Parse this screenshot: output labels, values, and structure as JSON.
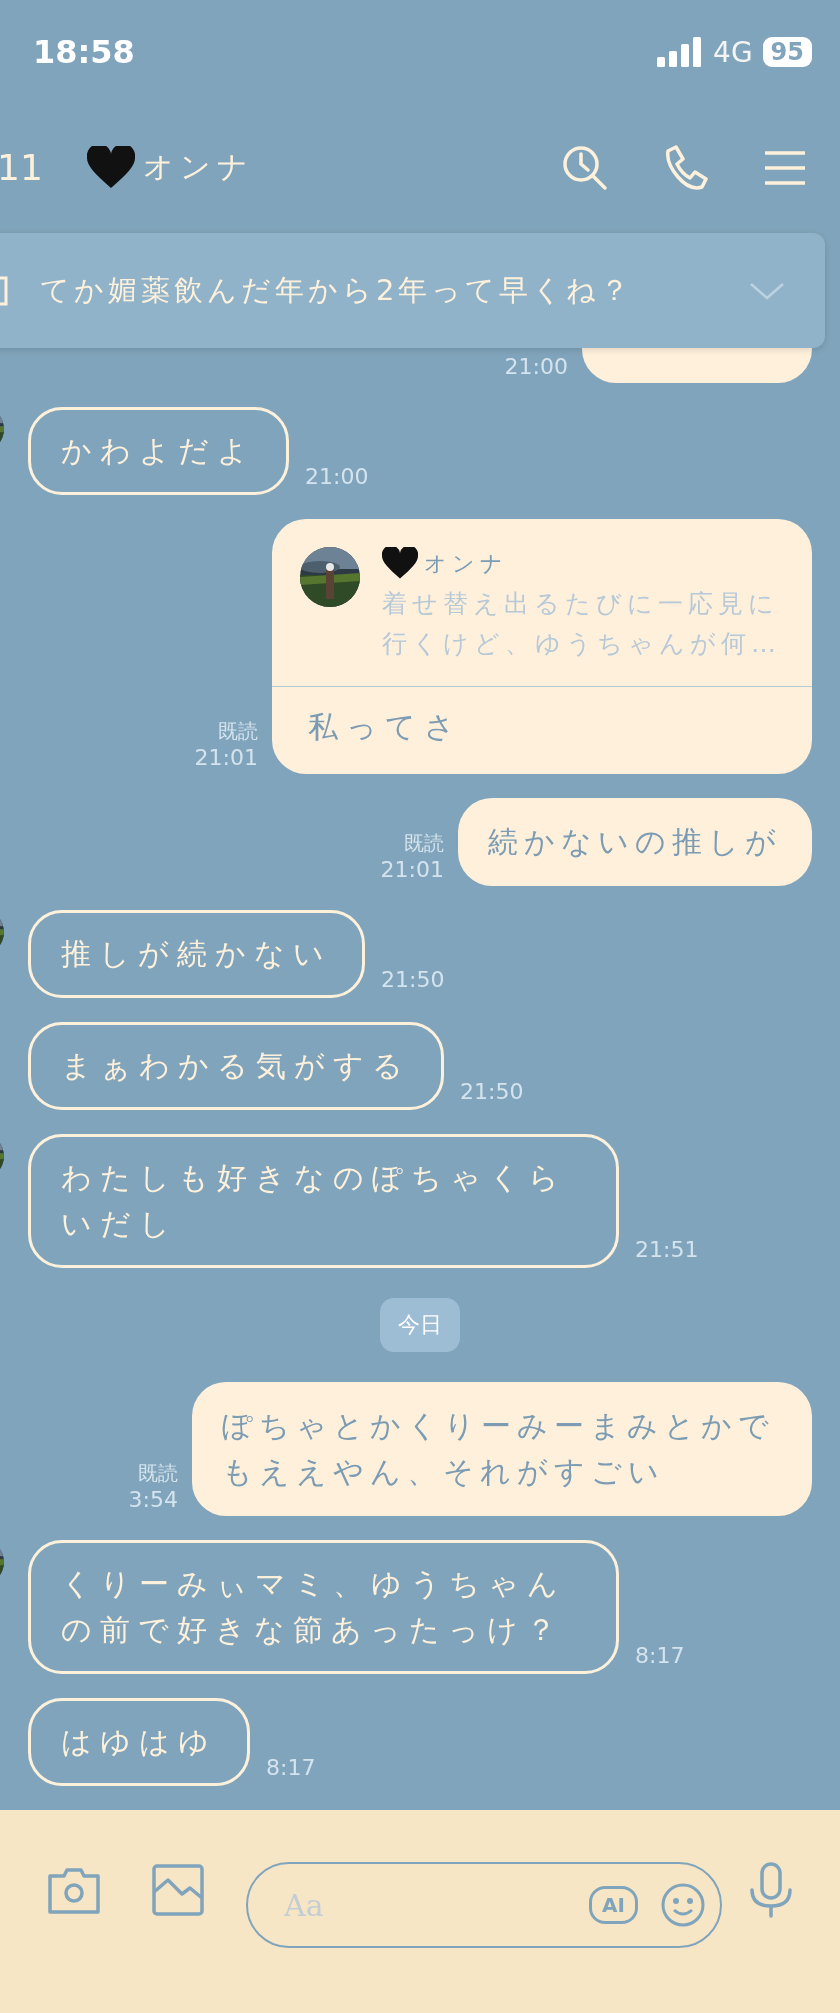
{
  "status_bar": {
    "time": "18:58",
    "network": "4G",
    "battery": "95"
  },
  "header": {
    "back_count": "11",
    "title": "オンナ"
  },
  "pinned": {
    "text": "てか媚薬飲んだ年から2年って早くね？"
  },
  "messages": [
    {
      "kind": "sent_covered",
      "time": "21:00"
    },
    {
      "kind": "received",
      "text": "かわよだよ",
      "time": "21:00",
      "with_avatar": true
    },
    {
      "kind": "reply",
      "quote_name": "オンナ",
      "quote_text": "着せ替え出るたびに一応見に行くけど、ゆうちゃんが何…",
      "text": "私ってさ",
      "read": "既読",
      "time": "21:01"
    },
    {
      "kind": "sent",
      "text": "続かないの推しが",
      "read": "既読",
      "time": "21:01"
    },
    {
      "kind": "received",
      "text": "推しが続かない",
      "time": "21:50",
      "with_avatar": true
    },
    {
      "kind": "received",
      "text": "まぁわかる気がする",
      "time": "21:50",
      "with_avatar": false
    },
    {
      "kind": "received",
      "text": "わたしも好きなのぽちゃくらいだし",
      "time": "21:51",
      "with_avatar": true
    },
    {
      "kind": "date",
      "text": "今日"
    },
    {
      "kind": "sent",
      "text": "ぽちゃとかくりーみーまみとかでもええやん、それがすごい",
      "read": "既読",
      "time": "3:54"
    },
    {
      "kind": "received",
      "text": "くりーみぃマミ、ゆうちゃんの前で好きな節あったっけ？",
      "time": "8:17",
      "with_avatar": true
    },
    {
      "kind": "received",
      "text": "はゆはゆ",
      "time": "8:17",
      "with_avatar": false
    }
  ],
  "input": {
    "placeholder": "Aa",
    "ai_label": "AI"
  }
}
